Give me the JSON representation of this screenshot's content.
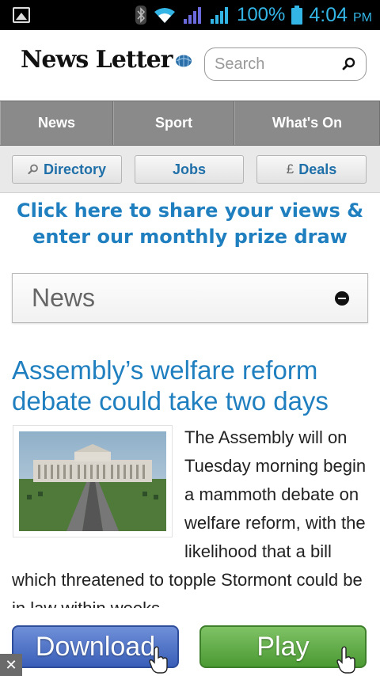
{
  "status_bar": {
    "battery_percent": "100%",
    "time": "4:04",
    "ampm": "PM",
    "icons": [
      "image-icon",
      "bluetooth-icon",
      "wifi-icon",
      "signal-icon",
      "signal-icon",
      "battery-icon"
    ]
  },
  "header": {
    "logo_text": "News Letter",
    "search_placeholder": "Search"
  },
  "primary_nav": {
    "items": [
      {
        "label": "News"
      },
      {
        "label": "Sport"
      },
      {
        "label": "What's On"
      }
    ]
  },
  "secondary_nav": {
    "items": [
      {
        "label": "Directory",
        "icon": "search-icon"
      },
      {
        "label": "Jobs"
      },
      {
        "label": "Deals",
        "icon": "pound-icon",
        "icon_text": "£"
      }
    ]
  },
  "promo": {
    "line1": "Click here to share your views &",
    "line2": "enter our monthly prize draw"
  },
  "section": {
    "title": "News"
  },
  "article": {
    "headline": "Assembly’s welfare reform debate could take two days",
    "body": "The Assembly will on Tuesday morning begin a mammoth debate on welfare reform, with the likelihood that a bill which threatened to topple Stormont could be in law within weeks."
  },
  "ad": {
    "download_label": "Download",
    "play_label": "Play",
    "close_label": "✕"
  },
  "colors": {
    "accent_blue": "#1f7fbf",
    "nav_gray": "#8a8a8a",
    "status_blue": "#33b5e5"
  }
}
